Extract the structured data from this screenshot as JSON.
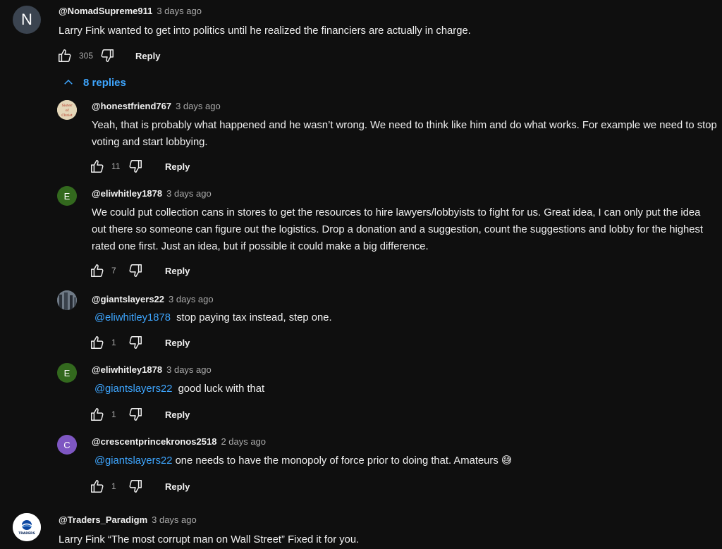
{
  "top_comment": {
    "avatar_letter": "N",
    "avatar_color": "#3b4450",
    "author": "@NomadSupreme911",
    "time": "3 days ago",
    "text": "Larry Fink wanted to get into politics until he realized the financiers are actually in charge.",
    "likes": "305",
    "reply_label": "Reply"
  },
  "replies_toggle": {
    "label": "8 replies",
    "icon": "chevron-up-icon"
  },
  "replies": [
    {
      "avatar_text": "Sister of Christ",
      "avatar_color": "#d9c9a8",
      "author": "@honestfriend767",
      "time": "3 days ago",
      "text": "Yeah, that is probably what happened and he wasn’t wrong. We need to think like him and do what works. For example we need to stop voting and start lobbying.",
      "likes": "11",
      "reply_label": "Reply"
    },
    {
      "avatar_letter": "E",
      "avatar_color": "#33691e",
      "author": "@eliwhitley1878",
      "time": "3 days ago",
      "text": "We could put collection cans in stores to get the resources to hire lawyers/lobbyists to fight for us. Great idea, I can only put the idea out there so someone can figure out the logistics. Drop a donation and a suggestion, count the suggestions and lobby for the highest rated one first. Just an idea, but if possible it could make a big difference.",
      "likes": "7",
      "reply_label": "Reply"
    },
    {
      "avatar_color": "#5a6470",
      "author": "@giantslayers22",
      "time": "3 days ago",
      "mention": "@eliwhitley1878",
      "text": "stop paying tax instead, step one.",
      "likes": "1",
      "reply_label": "Reply"
    },
    {
      "avatar_letter": "E",
      "avatar_color": "#33691e",
      "author": "@eliwhitley1878",
      "time": "3 days ago",
      "mention": "@giantslayers22",
      "text": "good luck with that",
      "likes": "1",
      "reply_label": "Reply"
    },
    {
      "avatar_letter": "C",
      "avatar_color": "#7e57c2",
      "author": "@crescentprincekronos2518",
      "time": "2 days ago",
      "mention": "@giantslayers22",
      "text": "one needs to have the monopoly of force prior to doing that. Amateurs 😅",
      "likes": "1",
      "reply_label": "Reply"
    }
  ],
  "bottom_comment": {
    "avatar_text": "TRADERS",
    "avatar_color": "#ffffff",
    "author": "@Traders_Paradigm",
    "time": "3 days ago",
    "text": "Larry Fink “The most corrupt man on Wall Street” Fixed it for you."
  },
  "colors": {
    "background": "#0f0f0f",
    "text": "#f1f1f1",
    "secondary": "#aaaaaa",
    "link": "#3ea6ff"
  }
}
